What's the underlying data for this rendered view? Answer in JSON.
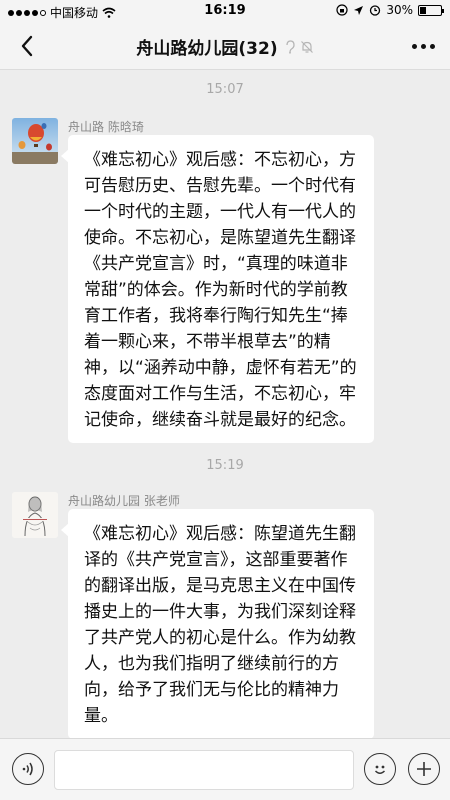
{
  "status_bar": {
    "carrier": "中国移动",
    "time": "16:19",
    "battery_text": "30%",
    "battery_level": 0.3
  },
  "header": {
    "title": "舟山路幼儿园(32)",
    "back_icon": "chevron-left-icon",
    "more_icon": "more-dots-icon"
  },
  "chat": {
    "messages": [
      {
        "time": "15:07",
        "sender": "舟山路 陈晗琦",
        "avatar_icon": "hot-air-balloon-avatar",
        "text": "《难忘初心》观后感：不忘初心，方可告慰历史、告慰先辈。一个时代有一个时代的主题，一代人有一代人的使命。不忘初心，是陈望道先生翻译《共产党宣言》时，“真理的味道非常甜”的体会。作为新时代的学前教育工作者，我将奉行陶行知先生“捧着一颗心来，不带半根草去”的精神，以“涵养动中静，虚怀有若无”的态度面对工作与生活，不忘初心，牢记使命，继续奋斗就是最好的纪念。"
      },
      {
        "time": "15:19",
        "sender": "舟山路幼儿园 张老师",
        "avatar_icon": "sketch-portrait-avatar",
        "text": "《难忘初心》观后感：陈望道先生翻译的《共产党宣言》，这部重要著作的翻译出版，是马克思主义在中国传播史上的一件大事，为我们深刻诠释了共产党人的初心是什么。作为幼教人，也为我们指明了继续前行的方向，给予了我们无与伦比的精神力量。"
      }
    ]
  },
  "input_bar": {
    "value": "",
    "voice_icon": "voice-icon",
    "emoji_icon": "emoji-icon",
    "plus_icon": "plus-icon"
  },
  "colors": {
    "background": "#ededed",
    "bubble": "#ffffff",
    "meta_text": "#a8a8a8"
  }
}
